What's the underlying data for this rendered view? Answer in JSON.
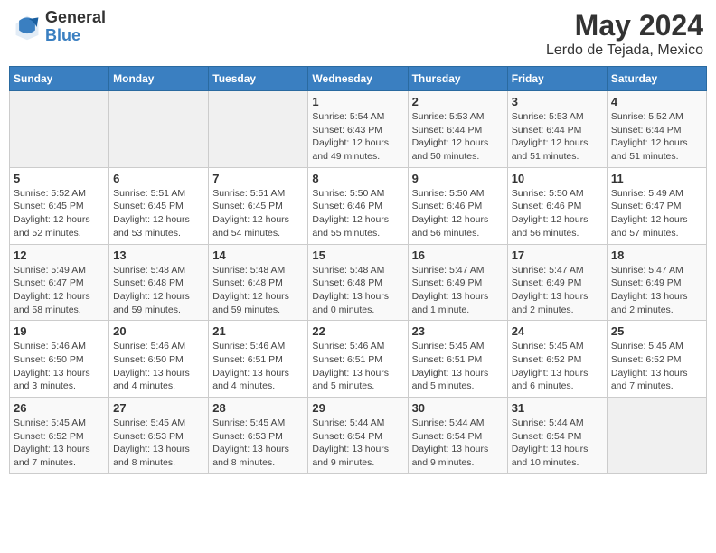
{
  "header": {
    "logo_line1": "General",
    "logo_line2": "Blue",
    "title": "May 2024",
    "subtitle": "Lerdo de Tejada, Mexico"
  },
  "weekdays": [
    "Sunday",
    "Monday",
    "Tuesday",
    "Wednesday",
    "Thursday",
    "Friday",
    "Saturday"
  ],
  "weeks": [
    [
      {
        "day": "",
        "info": ""
      },
      {
        "day": "",
        "info": ""
      },
      {
        "day": "",
        "info": ""
      },
      {
        "day": "1",
        "info": "Sunrise: 5:54 AM\nSunset: 6:43 PM\nDaylight: 12 hours\nand 49 minutes."
      },
      {
        "day": "2",
        "info": "Sunrise: 5:53 AM\nSunset: 6:44 PM\nDaylight: 12 hours\nand 50 minutes."
      },
      {
        "day": "3",
        "info": "Sunrise: 5:53 AM\nSunset: 6:44 PM\nDaylight: 12 hours\nand 51 minutes."
      },
      {
        "day": "4",
        "info": "Sunrise: 5:52 AM\nSunset: 6:44 PM\nDaylight: 12 hours\nand 51 minutes."
      }
    ],
    [
      {
        "day": "5",
        "info": "Sunrise: 5:52 AM\nSunset: 6:45 PM\nDaylight: 12 hours\nand 52 minutes."
      },
      {
        "day": "6",
        "info": "Sunrise: 5:51 AM\nSunset: 6:45 PM\nDaylight: 12 hours\nand 53 minutes."
      },
      {
        "day": "7",
        "info": "Sunrise: 5:51 AM\nSunset: 6:45 PM\nDaylight: 12 hours\nand 54 minutes."
      },
      {
        "day": "8",
        "info": "Sunrise: 5:50 AM\nSunset: 6:46 PM\nDaylight: 12 hours\nand 55 minutes."
      },
      {
        "day": "9",
        "info": "Sunrise: 5:50 AM\nSunset: 6:46 PM\nDaylight: 12 hours\nand 56 minutes."
      },
      {
        "day": "10",
        "info": "Sunrise: 5:50 AM\nSunset: 6:46 PM\nDaylight: 12 hours\nand 56 minutes."
      },
      {
        "day": "11",
        "info": "Sunrise: 5:49 AM\nSunset: 6:47 PM\nDaylight: 12 hours\nand 57 minutes."
      }
    ],
    [
      {
        "day": "12",
        "info": "Sunrise: 5:49 AM\nSunset: 6:47 PM\nDaylight: 12 hours\nand 58 minutes."
      },
      {
        "day": "13",
        "info": "Sunrise: 5:48 AM\nSunset: 6:48 PM\nDaylight: 12 hours\nand 59 minutes."
      },
      {
        "day": "14",
        "info": "Sunrise: 5:48 AM\nSunset: 6:48 PM\nDaylight: 12 hours\nand 59 minutes."
      },
      {
        "day": "15",
        "info": "Sunrise: 5:48 AM\nSunset: 6:48 PM\nDaylight: 13 hours\nand 0 minutes."
      },
      {
        "day": "16",
        "info": "Sunrise: 5:47 AM\nSunset: 6:49 PM\nDaylight: 13 hours\nand 1 minute."
      },
      {
        "day": "17",
        "info": "Sunrise: 5:47 AM\nSunset: 6:49 PM\nDaylight: 13 hours\nand 2 minutes."
      },
      {
        "day": "18",
        "info": "Sunrise: 5:47 AM\nSunset: 6:49 PM\nDaylight: 13 hours\nand 2 minutes."
      }
    ],
    [
      {
        "day": "19",
        "info": "Sunrise: 5:46 AM\nSunset: 6:50 PM\nDaylight: 13 hours\nand 3 minutes."
      },
      {
        "day": "20",
        "info": "Sunrise: 5:46 AM\nSunset: 6:50 PM\nDaylight: 13 hours\nand 4 minutes."
      },
      {
        "day": "21",
        "info": "Sunrise: 5:46 AM\nSunset: 6:51 PM\nDaylight: 13 hours\nand 4 minutes."
      },
      {
        "day": "22",
        "info": "Sunrise: 5:46 AM\nSunset: 6:51 PM\nDaylight: 13 hours\nand 5 minutes."
      },
      {
        "day": "23",
        "info": "Sunrise: 5:45 AM\nSunset: 6:51 PM\nDaylight: 13 hours\nand 5 minutes."
      },
      {
        "day": "24",
        "info": "Sunrise: 5:45 AM\nSunset: 6:52 PM\nDaylight: 13 hours\nand 6 minutes."
      },
      {
        "day": "25",
        "info": "Sunrise: 5:45 AM\nSunset: 6:52 PM\nDaylight: 13 hours\nand 7 minutes."
      }
    ],
    [
      {
        "day": "26",
        "info": "Sunrise: 5:45 AM\nSunset: 6:52 PM\nDaylight: 13 hours\nand 7 minutes."
      },
      {
        "day": "27",
        "info": "Sunrise: 5:45 AM\nSunset: 6:53 PM\nDaylight: 13 hours\nand 8 minutes."
      },
      {
        "day": "28",
        "info": "Sunrise: 5:45 AM\nSunset: 6:53 PM\nDaylight: 13 hours\nand 8 minutes."
      },
      {
        "day": "29",
        "info": "Sunrise: 5:44 AM\nSunset: 6:54 PM\nDaylight: 13 hours\nand 9 minutes."
      },
      {
        "day": "30",
        "info": "Sunrise: 5:44 AM\nSunset: 6:54 PM\nDaylight: 13 hours\nand 9 minutes."
      },
      {
        "day": "31",
        "info": "Sunrise: 5:44 AM\nSunset: 6:54 PM\nDaylight: 13 hours\nand 10 minutes."
      },
      {
        "day": "",
        "info": ""
      }
    ]
  ]
}
